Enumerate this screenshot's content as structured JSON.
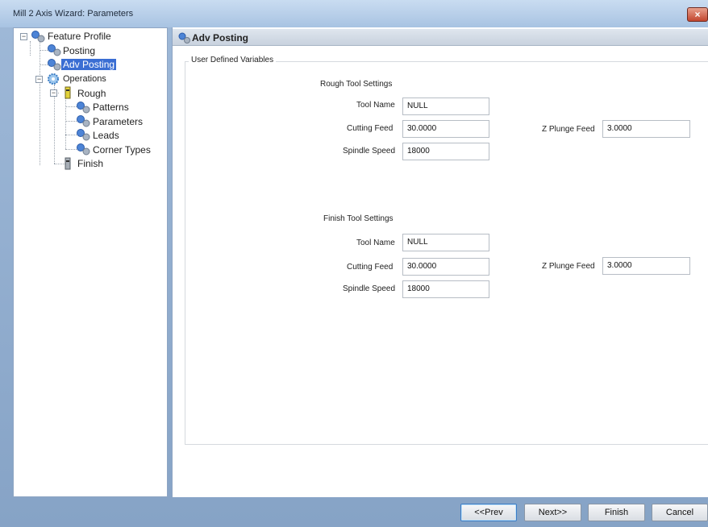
{
  "window": {
    "title": "Mill 2 Axis Wizard: Parameters",
    "close_glyph": "×"
  },
  "tree": {
    "items": [
      {
        "label": "Feature Profile",
        "icon": "gears-icon"
      },
      {
        "label": "Posting",
        "icon": "gears-icon"
      },
      {
        "label": "Adv Posting",
        "icon": "gears-icon",
        "selected": true
      },
      {
        "label": "Operations",
        "icon": "gear-icon"
      },
      {
        "label": "Rough",
        "icon": "tool-icon"
      },
      {
        "label": "Patterns",
        "icon": "gears-icon"
      },
      {
        "label": "Parameters",
        "icon": "gears-icon"
      },
      {
        "label": "Leads",
        "icon": "gears-icon"
      },
      {
        "label": "Corner Types",
        "icon": "gears-icon"
      },
      {
        "label": "Finish",
        "icon": "tool-icon"
      }
    ],
    "expander_minus": "−"
  },
  "panel": {
    "title": "Adv Posting",
    "group_label": "User Defined Variables",
    "rough": {
      "heading": "Rough Tool Settings",
      "tool_name_label": "Tool Name",
      "tool_name_value": "NULL",
      "cutting_feed_label": "Cutting Feed",
      "cutting_feed_value": "30.0000",
      "spindle_speed_label": "Spindle Speed",
      "spindle_speed_value": "18000",
      "z_plunge_label": "Z Plunge Feed",
      "z_plunge_value": "3.0000"
    },
    "finish": {
      "heading": "Finish Tool Settings",
      "tool_name_label": "Tool Name",
      "tool_name_value": "NULL",
      "cutting_feed_label": "Cutting Feed",
      "cutting_feed_value": "30.0000",
      "spindle_speed_label": "Spindle Speed",
      "spindle_speed_value": "18000",
      "z_plunge_label": "Z Plunge Feed",
      "z_plunge_value": "3.0000"
    }
  },
  "buttons": {
    "prev": "<<Prev",
    "next": "Next>>",
    "finish": "Finish",
    "cancel": "Cancel"
  },
  "colors": {
    "selection": "#3a6ed3",
    "window_frame": "#9fb9d8"
  }
}
